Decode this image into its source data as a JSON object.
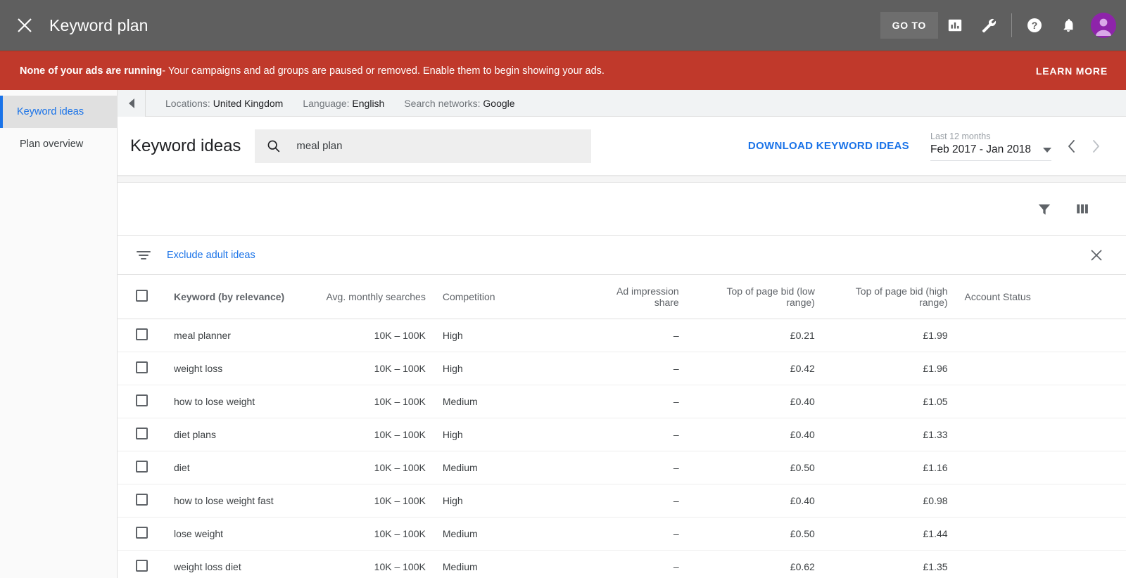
{
  "appbar": {
    "title": "Keyword plan",
    "close_icon": "close-icon",
    "goto_label": "GO TO",
    "reports_icon": "bar-chart-icon",
    "tools_icon": "wrench-icon",
    "help_icon": "help-icon",
    "notifications_icon": "bell-icon",
    "avatar_icon": "account-avatar"
  },
  "alert": {
    "bold": "None of your ads are running",
    "rest": " - Your campaigns and ad groups are paused or removed. Enable them to begin showing your ads.",
    "learn_more": "LEARN MORE",
    "color": "#c0392b"
  },
  "sidebar": {
    "items": [
      {
        "label": "Keyword ideas",
        "active": true
      },
      {
        "label": "Plan overview",
        "active": false
      }
    ]
  },
  "settings_bar": {
    "collapse_icon": "collapse-left-icon",
    "locations_label": "Locations:",
    "locations_value": "United Kingdom",
    "language_label": "Language:",
    "language_value": "English",
    "networks_label": "Search networks:",
    "networks_value": "Google"
  },
  "page": {
    "title": "Keyword ideas",
    "search_value": "meal plan",
    "search_icon": "search-icon",
    "download_label": "DOWNLOAD KEYWORD IDEAS",
    "date_label": "Last 12 months",
    "date_value": "Feb 2017 - Jan 2018",
    "prev_icon": "chevron-left-icon",
    "next_icon": "chevron-right-icon"
  },
  "toolbar": {
    "filter_icon": "funnel-filter-icon",
    "columns_icon": "columns-icon"
  },
  "filter_chip": {
    "icon": "filter-lines-icon",
    "label": "Exclude adult ideas",
    "close_icon": "close-icon"
  },
  "table": {
    "columns": [
      "Keyword (by relevance)",
      "Avg. monthly searches",
      "Competition",
      "Ad impression share",
      "Top of page bid (low range)",
      "Top of page bid (high range)",
      "Account Status"
    ],
    "rows": [
      {
        "keyword": "meal planner",
        "avg_searches": "10K – 100K",
        "competition": "High",
        "impression_share": "–",
        "bid_low": "£0.21",
        "bid_high": "£1.99",
        "account_status": ""
      },
      {
        "keyword": "weight loss",
        "avg_searches": "10K – 100K",
        "competition": "High",
        "impression_share": "–",
        "bid_low": "£0.42",
        "bid_high": "£1.96",
        "account_status": ""
      },
      {
        "keyword": "how to lose weight",
        "avg_searches": "10K – 100K",
        "competition": "Medium",
        "impression_share": "–",
        "bid_low": "£0.40",
        "bid_high": "£1.05",
        "account_status": ""
      },
      {
        "keyword": "diet plans",
        "avg_searches": "10K – 100K",
        "competition": "High",
        "impression_share": "–",
        "bid_low": "£0.40",
        "bid_high": "£1.33",
        "account_status": ""
      },
      {
        "keyword": "diet",
        "avg_searches": "10K – 100K",
        "competition": "Medium",
        "impression_share": "–",
        "bid_low": "£0.50",
        "bid_high": "£1.16",
        "account_status": ""
      },
      {
        "keyword": "how to lose weight fast",
        "avg_searches": "10K – 100K",
        "competition": "High",
        "impression_share": "–",
        "bid_low": "£0.40",
        "bid_high": "£0.98",
        "account_status": ""
      },
      {
        "keyword": "lose weight",
        "avg_searches": "10K – 100K",
        "competition": "Medium",
        "impression_share": "–",
        "bid_low": "£0.50",
        "bid_high": "£1.44",
        "account_status": ""
      },
      {
        "keyword": "weight loss diet",
        "avg_searches": "10K – 100K",
        "competition": "Medium",
        "impression_share": "–",
        "bid_low": "£0.62",
        "bid_high": "£1.35",
        "account_status": ""
      }
    ]
  }
}
